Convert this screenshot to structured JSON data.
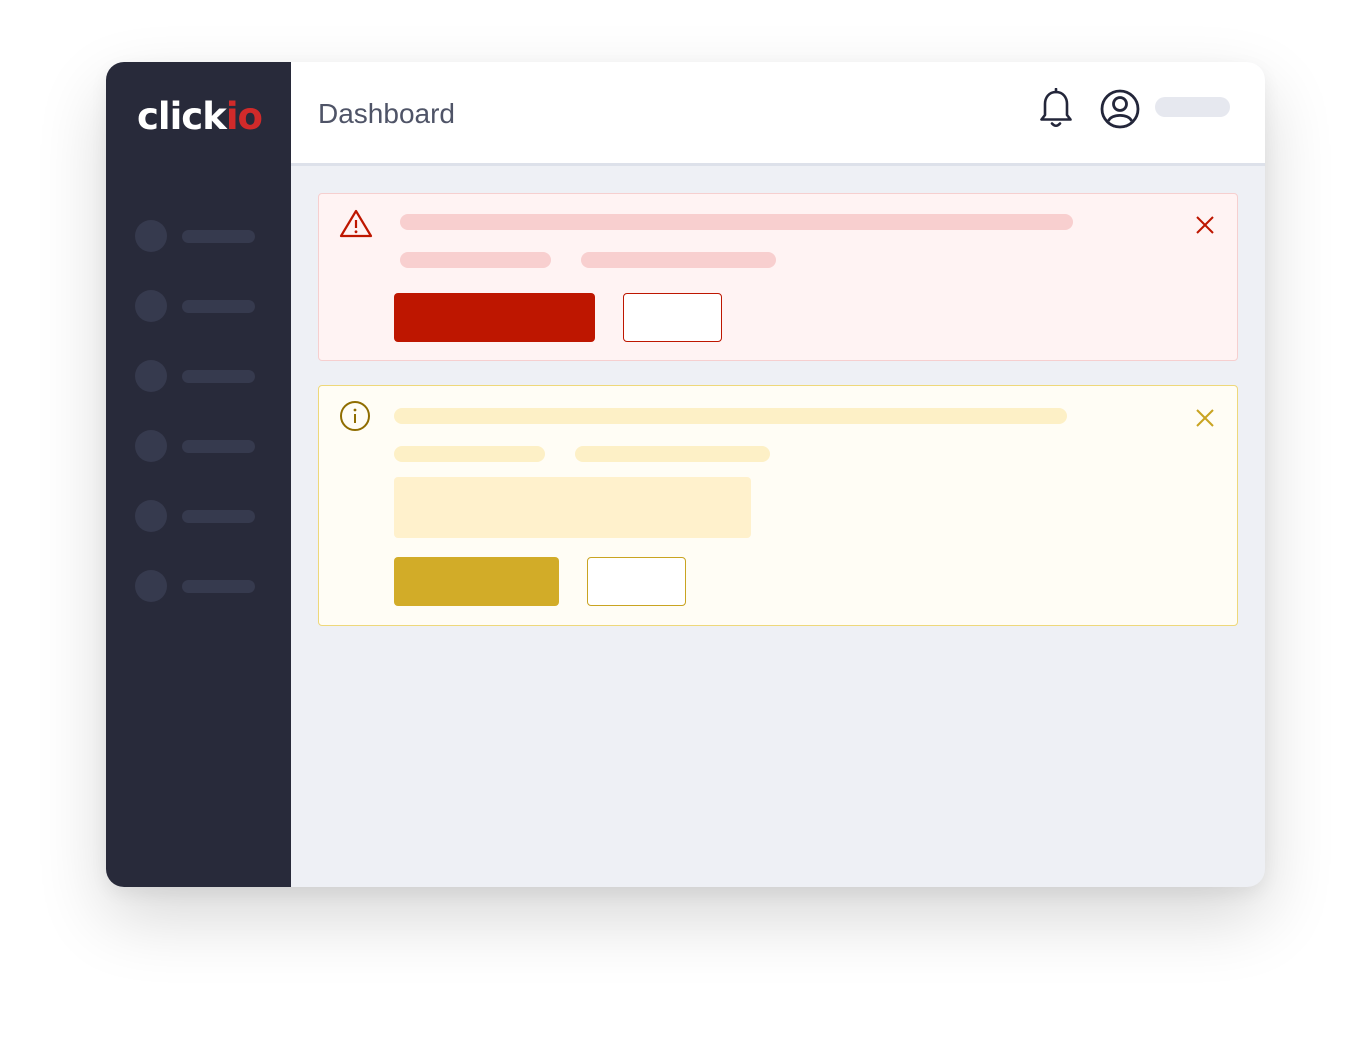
{
  "brand": {
    "logo_main": "click",
    "logo_accent": "io",
    "accent_color": "#d12a2a"
  },
  "colors": {
    "sidebar": "#282a3a",
    "error": "#be1600",
    "warning": "#d2ac28",
    "page_background": "#eef0f5"
  },
  "header": {
    "title": "Dashboard",
    "icons": [
      "bell-icon",
      "user-circle-icon"
    ]
  },
  "sidebar": {
    "nav_item_count": 6
  },
  "banners": [
    {
      "type": "error",
      "icon": "warning-triangle-icon",
      "close_icon": "close-icon"
    },
    {
      "type": "warning",
      "icon": "info-circle-icon",
      "close_icon": "close-icon"
    }
  ]
}
